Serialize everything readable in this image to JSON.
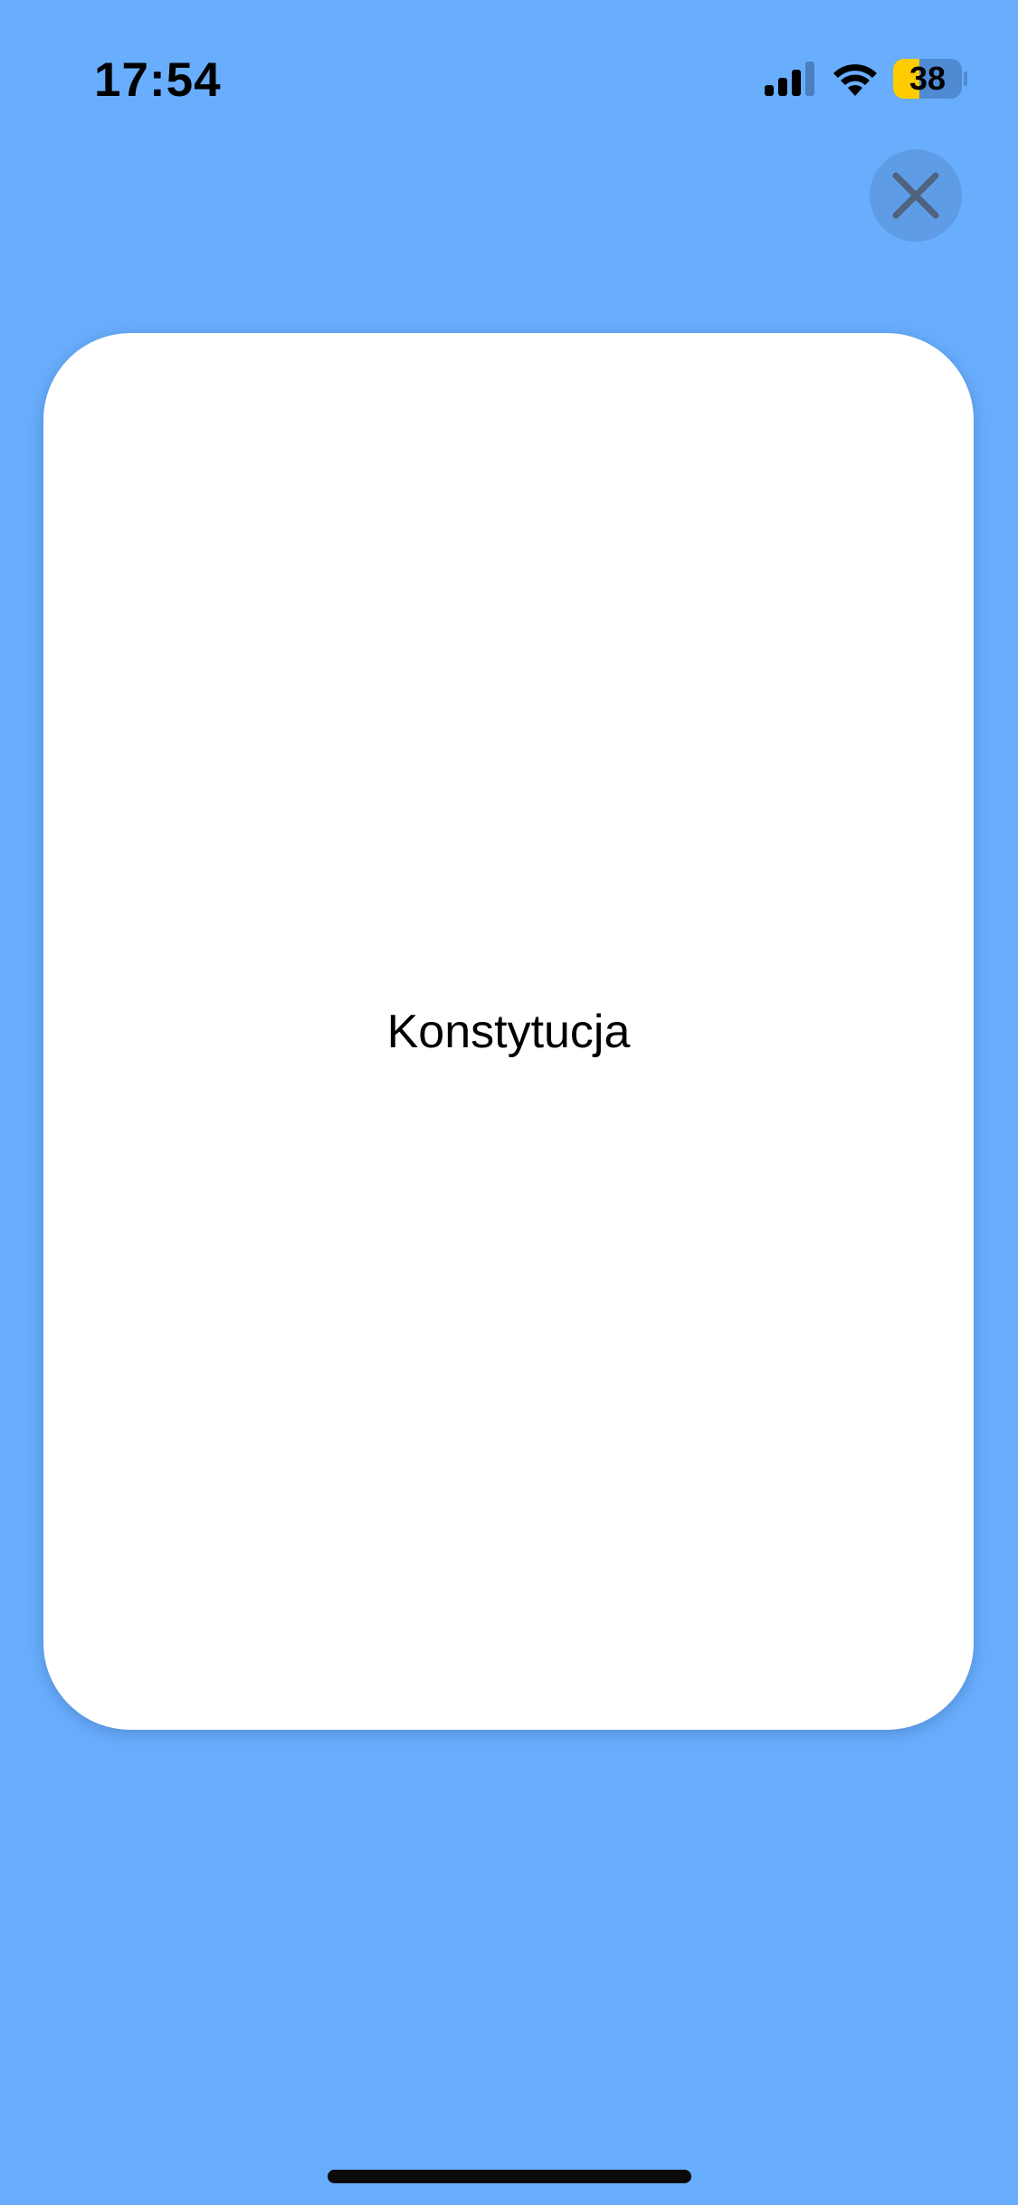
{
  "status_bar": {
    "time": "17:54",
    "battery_level": "38",
    "battery_fraction": 0.38,
    "battery_color": "#FFCC00",
    "icons": [
      "signal-icon",
      "wifi-icon",
      "battery-icon"
    ]
  },
  "close_button": {
    "icon": "close-icon",
    "background": "#5E9DE6",
    "icon_color": "#4F637E"
  },
  "card": {
    "text": "Konstytucja"
  },
  "colors": {
    "background": "#69AEFD",
    "card": "#FFFFFF"
  }
}
